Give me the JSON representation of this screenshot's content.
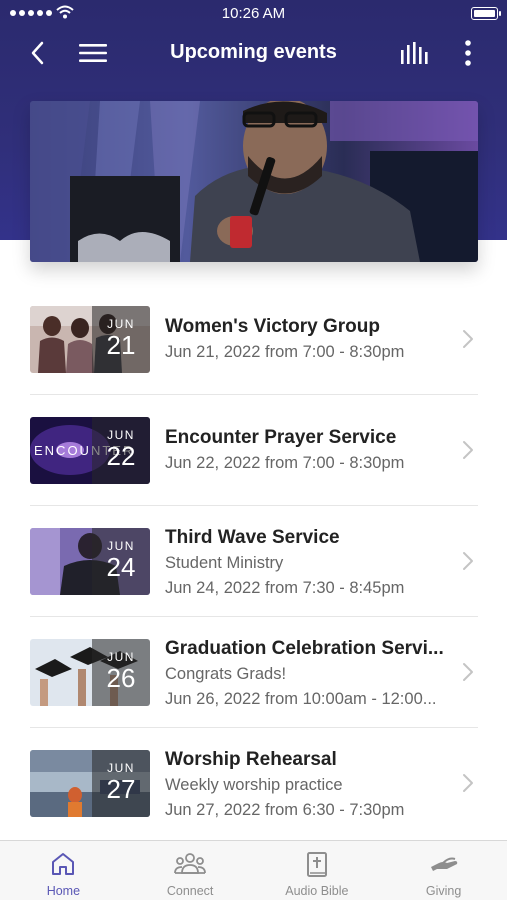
{
  "status_bar": {
    "time": "10:26 AM"
  },
  "navbar": {
    "title": "Upcoming events"
  },
  "events": [
    {
      "month": "JUN",
      "day": "21",
      "title": "Women's Victory Group",
      "lines": [
        "Jun 21, 2022 from 7:00 - 8:30pm"
      ]
    },
    {
      "month": "JUN",
      "day": "22",
      "title": "Encounter Prayer Service",
      "lines": [
        "Jun 22, 2022 from 7:00 - 8:30pm"
      ],
      "thumb_text": "ENCOUNTER"
    },
    {
      "month": "JUN",
      "day": "24",
      "title": "Third Wave Service",
      "lines": [
        "Student Ministry",
        "Jun 24, 2022 from 7:30 - 8:45pm"
      ]
    },
    {
      "month": "JUN",
      "day": "26",
      "title": "Graduation Celebration Servi...",
      "lines": [
        "Congrats Grads!",
        "Jun 26, 2022 from 10:00am - 12:00..."
      ]
    },
    {
      "month": "JUN",
      "day": "27",
      "title": "Worship Rehearsal",
      "lines": [
        "Weekly worship practice",
        "Jun 27, 2022 from 6:30 - 7:30pm"
      ]
    }
  ],
  "tabbar": {
    "tabs": [
      {
        "label": "Home",
        "icon": "home-icon",
        "active": true
      },
      {
        "label": "Connect",
        "icon": "people-icon",
        "active": false
      },
      {
        "label": "Audio Bible",
        "icon": "bible-icon",
        "active": false
      },
      {
        "label": "Giving",
        "icon": "giving-hand-icon",
        "active": false
      }
    ]
  },
  "colors": {
    "header": "#2b2a6e",
    "accent": "#5a57b5",
    "tab_inactive": "#8e8e8e"
  }
}
